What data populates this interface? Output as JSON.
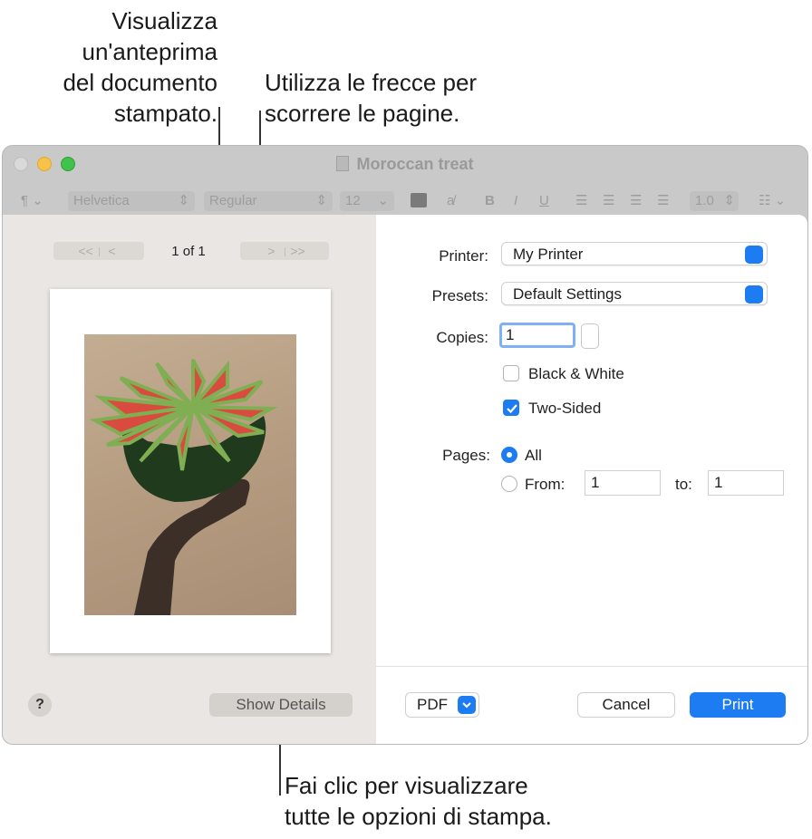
{
  "callouts": {
    "preview": [
      "Visualizza",
      "un'anteprima",
      "del documento",
      "stampato."
    ],
    "arrows": [
      "Utilizza le frecce per",
      "scorrere le pagine."
    ],
    "details": [
      "Fai clic per visualizzare",
      "tutte le opzioni di stampa."
    ]
  },
  "window": {
    "title": "Moroccan treat",
    "toolbar": {
      "paragraph": "¶",
      "font": "Helvetica",
      "style": "Regular",
      "size": "12",
      "bold": "B",
      "italic": "I",
      "underline": "U",
      "line_spacing": "1.0",
      "list_icon": "list-icon"
    }
  },
  "preview": {
    "page_count": "1 of 1",
    "nav_first": "<<",
    "nav_prev": "<",
    "nav_next": ">",
    "nav_last": ">>",
    "show_details": "Show Details",
    "help": "?"
  },
  "settings": {
    "printer_label": "Printer:",
    "printer_value": "My Printer",
    "presets_label": "Presets:",
    "presets_value": "Default Settings",
    "copies_label": "Copies:",
    "copies_value": "1",
    "black_white_label": "Black & White",
    "black_white_checked": false,
    "two_sided_label": "Two-Sided",
    "two_sided_checked": true,
    "pages_label": "Pages:",
    "pages_all_label": "All",
    "pages_from_label": "From:",
    "pages_from_value": "1",
    "pages_to_label": "to:",
    "pages_to_value": "1"
  },
  "footer": {
    "pdf_label": "PDF",
    "cancel_label": "Cancel",
    "print_label": "Print"
  },
  "colors": {
    "accent": "#1e7cf2",
    "close": "#d9d9d9",
    "minimize": "#f7c24a",
    "maximize": "#3fc34a"
  }
}
